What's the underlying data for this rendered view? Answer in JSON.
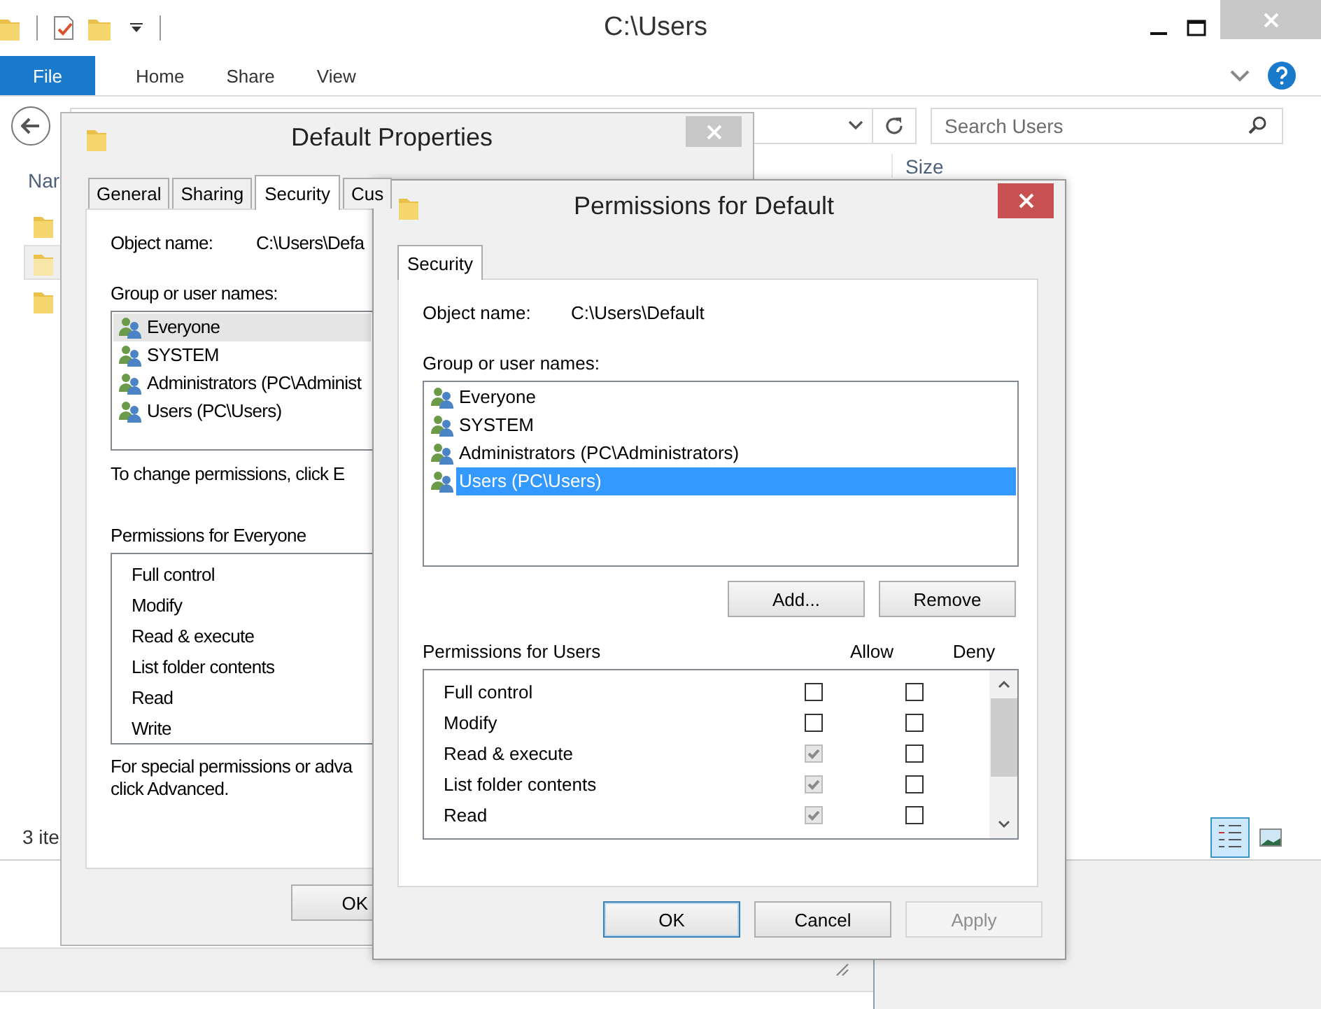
{
  "explorer": {
    "title": "C:\\Users",
    "file_tab": "File",
    "ribbon_tabs": [
      {
        "label": "Home"
      },
      {
        "label": "Share"
      },
      {
        "label": "View"
      }
    ],
    "search": {
      "placeholder": "Search Users"
    },
    "name_header": "Nar",
    "size_header": "Size",
    "nav_items": [
      {
        "selected": false
      },
      {
        "selected": true
      },
      {
        "selected": false
      }
    ],
    "status": "3 ite",
    "view_buttons": [
      {
        "kind": "details",
        "selected": true
      },
      {
        "kind": "thumbnails",
        "selected": false
      }
    ]
  },
  "properties_dialog": {
    "title": "Default Properties",
    "tabs": [
      {
        "label": "General",
        "selected": false
      },
      {
        "label": "Sharing",
        "selected": false
      },
      {
        "label": "Security",
        "selected": true
      },
      {
        "label": "Cus",
        "selected": false
      }
    ],
    "object_label": "Object name:",
    "object_value": "C:\\Users\\Defa",
    "group_label": "Group or user names:",
    "principals": [
      {
        "name": "Everyone",
        "selected": true
      },
      {
        "name": "SYSTEM",
        "selected": false
      },
      {
        "name": "Administrators (PC\\Administ",
        "selected": false
      },
      {
        "name": "Users (PC\\Users)",
        "selected": false
      }
    ],
    "change_note": "To change permissions, click E",
    "permissions_label": "Permissions for Everyone",
    "permissions": [
      "Full control",
      "Modify",
      "Read & execute",
      "List folder contents",
      "Read",
      "Write"
    ],
    "special_note_lines": [
      "For special permissions or adva",
      "click Advanced."
    ],
    "ok": "OK"
  },
  "permissions_dialog": {
    "title": "Permissions for Default",
    "tabs": [
      {
        "label": "Security",
        "selected": true
      }
    ],
    "object_label": "Object name:",
    "object_value": "C:\\Users\\Default",
    "group_label": "Group or user names:",
    "principals": [
      {
        "name": "Everyone",
        "selected": false
      },
      {
        "name": "SYSTEM",
        "selected": false
      },
      {
        "name": "Administrators (PC\\Administrators)",
        "selected": false
      },
      {
        "name": "Users (PC\\Users)",
        "selected": true
      }
    ],
    "add": "Add...",
    "remove": "Remove",
    "permissions_label": "Permissions for Users",
    "allow_heading": "Allow",
    "deny_heading": "Deny",
    "permissions": [
      {
        "name": "Full control",
        "allow": false,
        "allow_disabled": false,
        "deny": false
      },
      {
        "name": "Modify",
        "allow": false,
        "allow_disabled": false,
        "deny": false
      },
      {
        "name": "Read & execute",
        "allow": true,
        "allow_disabled": true,
        "deny": false
      },
      {
        "name": "List folder contents",
        "allow": true,
        "allow_disabled": true,
        "deny": false
      },
      {
        "name": "Read",
        "allow": true,
        "allow_disabled": true,
        "deny": false
      }
    ],
    "buttons": [
      {
        "label": "OK",
        "kind": "default",
        "disabled": false
      },
      {
        "label": "Cancel",
        "kind": "normal",
        "disabled": false
      },
      {
        "label": "Apply",
        "kind": "normal",
        "disabled": true
      }
    ]
  }
}
